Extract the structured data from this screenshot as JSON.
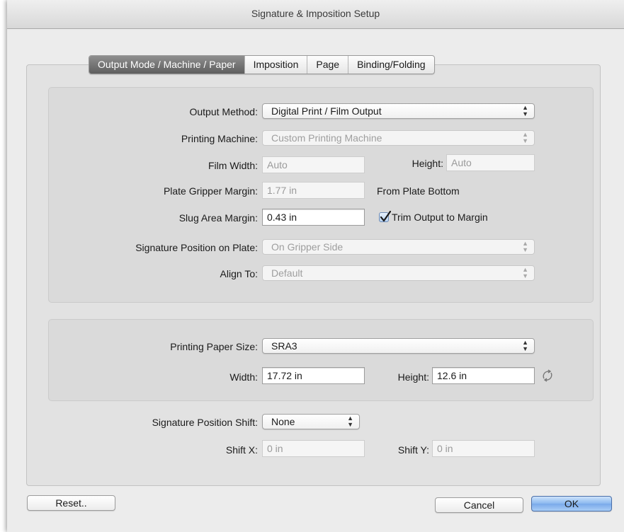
{
  "window": {
    "title": "Signature & Imposition Setup"
  },
  "tabs": [
    {
      "label": "Output Mode / Machine / Paper",
      "active": true
    },
    {
      "label": "Imposition",
      "active": false
    },
    {
      "label": "Page",
      "active": false
    },
    {
      "label": "Binding/Folding",
      "active": false
    }
  ],
  "output": {
    "method_label": "Output Method:",
    "method_value": "Digital Print / Film Output",
    "machine_label": "Printing Machine:",
    "machine_value": "Custom Printing Machine",
    "film_width_label": "Film Width:",
    "film_width_value": "Auto",
    "height_label": "Height:",
    "height_value": "Auto",
    "gripper_label": "Plate Gripper Margin:",
    "gripper_value": "1.77 in",
    "gripper_note": "From Plate Bottom",
    "slug_label": "Slug Area Margin:",
    "slug_value": "0.43 in",
    "trim_label": "Trim Output to Margin",
    "trim_checked": true,
    "sigpos_label": "Signature Position on Plate:",
    "sigpos_value": "On Gripper Side",
    "align_label": "Align To:",
    "align_value": "Default"
  },
  "paper": {
    "size_label": "Printing Paper Size:",
    "size_value": "SRA3",
    "width_label": "Width:",
    "width_value": "17.72 in",
    "height_label": "Height:",
    "height_value": "12.6 in"
  },
  "shift": {
    "label": "Signature Position Shift:",
    "value": "None",
    "x_label": "Shift X:",
    "x_value": "0 in",
    "y_label": "Shift Y:",
    "y_value": "0 in"
  },
  "buttons": {
    "reset": "Reset..",
    "cancel": "Cancel",
    "ok": "OK"
  },
  "icons": {
    "popup_arrows": "updown-arrows-icon",
    "swap": "swap-orientation-icon",
    "check": "checkmark-icon"
  }
}
